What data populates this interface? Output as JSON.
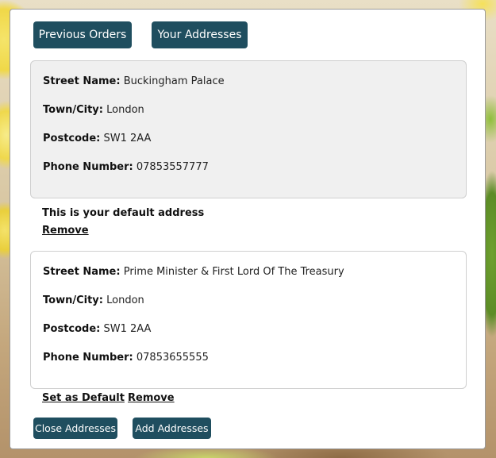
{
  "tabs": {
    "previous_orders": "Previous Orders",
    "your_addresses": "Your Addresses"
  },
  "addresses": [
    {
      "street_label": "Street Name:",
      "street": "Buckingham Palace",
      "town_label": "Town/City:",
      "town": "London",
      "postcode_label": "Postcode:",
      "postcode": "SW1 2AA",
      "phone_label": "Phone Number:",
      "phone": "07853557777",
      "default_note": "This is your default address",
      "remove": "Remove"
    },
    {
      "street_label": "Street Name:",
      "street": "Prime Minister & First Lord Of The Treasury",
      "town_label": "Town/City:",
      "town": "London",
      "postcode_label": "Postcode:",
      "postcode": "SW1 2AA",
      "phone_label": "Phone Number:",
      "phone": "07853655555",
      "set_default": "Set as Default",
      "remove": "Remove"
    }
  ],
  "actions": {
    "close_addresses": "Close Addresses",
    "add_addresses": "Add Addresses"
  },
  "colors": {
    "button_bg": "#1f4e5f",
    "default_card_bg": "#f0f0f0"
  }
}
